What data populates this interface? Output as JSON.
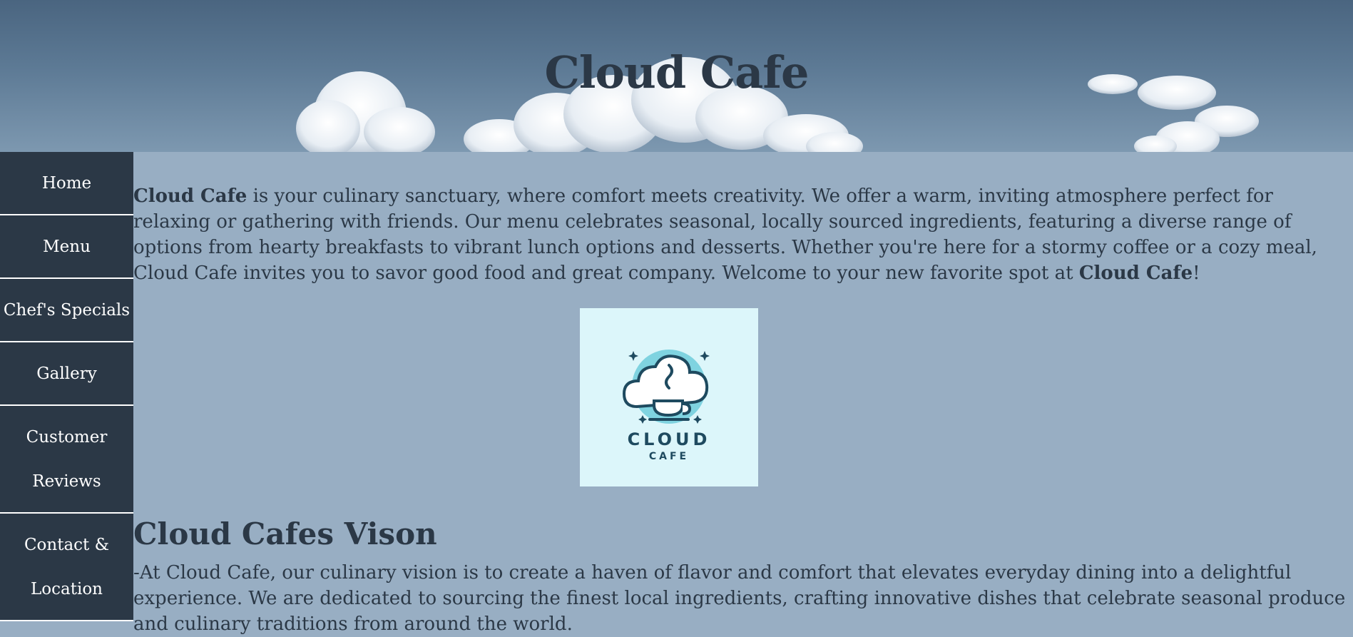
{
  "header": {
    "title": "Cloud Cafe"
  },
  "nav": {
    "items": [
      {
        "label": "Home"
      },
      {
        "label": "Menu"
      },
      {
        "label": "Chef's Specials"
      },
      {
        "label": "Gallery"
      },
      {
        "label_line1": "Customer",
        "label_line2": "Reviews"
      },
      {
        "label_line1": "Contact &",
        "label_line2": "Location"
      }
    ]
  },
  "intro": {
    "brand_start": "Cloud Cafe",
    "text": " is your culinary sanctuary, where comfort meets creativity. We offer a warm, inviting atmosphere perfect for relaxing or gathering with friends. Our menu celebrates seasonal, locally sourced ingredients, featuring a diverse range of options from hearty breakfasts to vibrant lunch options and desserts. Whether you're here for a stormy coffee or a cozy meal, Cloud Cafe invites you to savor good food and great company. Welcome to your new favorite spot at ",
    "brand_end": "Cloud Cafe",
    "end_punct": "!"
  },
  "logo": {
    "word_top": "CLOUD",
    "word_bottom": "CAFE"
  },
  "vision": {
    "heading": "Cloud Cafes Vison",
    "text": "-At Cloud Cafe, our culinary vision is to create a haven of flavor and comfort that elevates everyday dining into a delightful experience. We are dedicated to sourcing the finest local ingredients, crafting innovative dishes that celebrate seasonal produce and culinary traditions from around the world."
  },
  "colors": {
    "page_bg": "#98aec3",
    "sidebar_bg": "#2b3846",
    "text": "#2b3846",
    "logo_bg": "#dcf6fa",
    "logo_accent": "#7fd3e0",
    "logo_dark": "#1e4a5f"
  }
}
